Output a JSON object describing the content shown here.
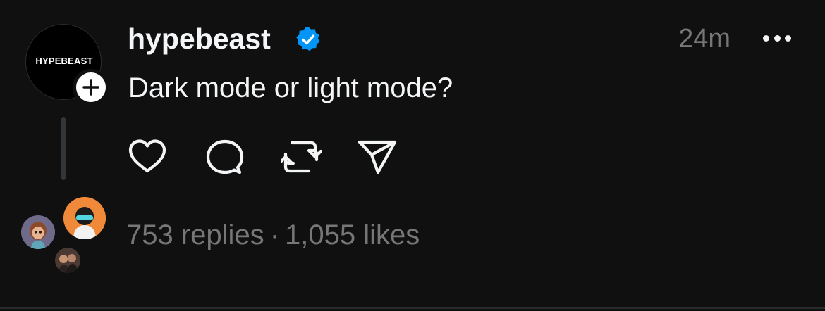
{
  "post": {
    "author": {
      "username": "hypebeast",
      "avatar_text": "HYPEBEAST",
      "verified": true,
      "verified_color": "#0095f6"
    },
    "timestamp": "24m",
    "text": "Dark mode or light mode?",
    "actions": [
      {
        "name": "like",
        "icon": "heart-icon"
      },
      {
        "name": "reply",
        "icon": "comment-icon"
      },
      {
        "name": "repost",
        "icon": "repost-icon"
      },
      {
        "name": "share",
        "icon": "send-icon"
      }
    ],
    "stats": {
      "replies": "753 replies",
      "separator": "·",
      "likes": "1,055 likes"
    }
  },
  "colors": {
    "background": "#101010",
    "primary_text": "#f3f5f7",
    "secondary_text": "#777777",
    "thread_line": "#333638"
  }
}
